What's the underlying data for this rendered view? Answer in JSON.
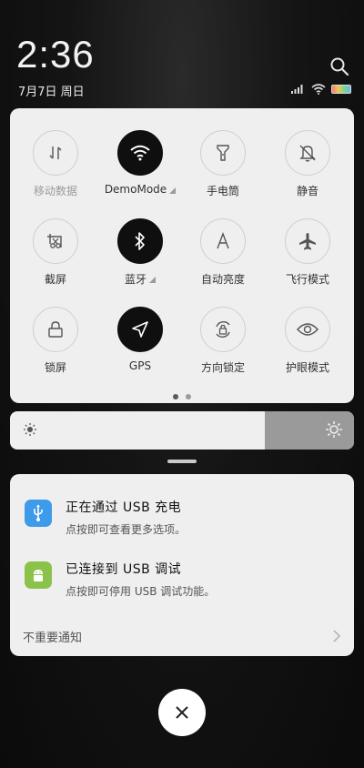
{
  "header": {
    "time": "2:36",
    "date": "7月7日 周日"
  },
  "quick_settings": {
    "tiles": [
      {
        "label": "移动数据",
        "icon": "mobile-data-icon",
        "active": false,
        "dim": true
      },
      {
        "label": "DemoMode",
        "icon": "wifi-icon",
        "active": true,
        "more": true
      },
      {
        "label": "手电筒",
        "icon": "flashlight-icon",
        "active": false
      },
      {
        "label": "静音",
        "icon": "mute-bell-icon",
        "active": false
      },
      {
        "label": "截屏",
        "icon": "screenshot-icon",
        "active": false
      },
      {
        "label": "蓝牙",
        "icon": "bluetooth-icon",
        "active": true,
        "more": true
      },
      {
        "label": "自动亮度",
        "icon": "auto-brightness-icon",
        "active": false
      },
      {
        "label": "飞行模式",
        "icon": "airplane-icon",
        "active": false
      },
      {
        "label": "锁屏",
        "icon": "lock-icon",
        "active": false
      },
      {
        "label": "GPS",
        "icon": "location-arrow-icon",
        "active": true
      },
      {
        "label": "方向锁定",
        "icon": "rotation-lock-icon",
        "active": false
      },
      {
        "label": "护眼模式",
        "icon": "eye-icon",
        "active": false
      }
    ],
    "page_count": 2,
    "current_page": 1
  },
  "brightness": {
    "level": 0.74
  },
  "notifications": [
    {
      "title": "正在通过 USB 充电",
      "body": "点按即可查看更多选项。",
      "icon": "usb-icon",
      "color": "#3d9be9"
    },
    {
      "title": "已连接到 USB 调试",
      "body": "点按即可停用 USB 调试功能。",
      "icon": "android-icon",
      "color": "#8bc34a"
    }
  ],
  "unimportant_label": "不重要通知"
}
